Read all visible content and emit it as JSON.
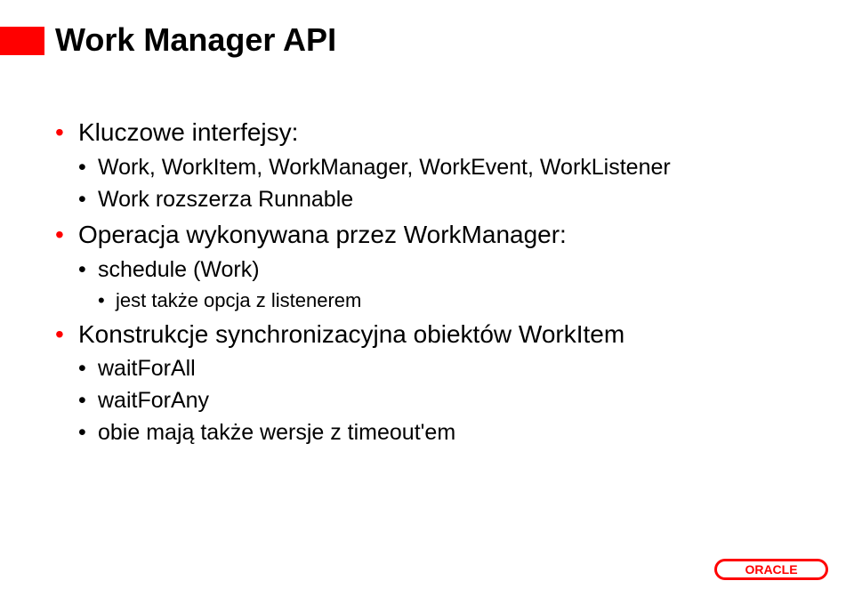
{
  "title": "Work Manager API",
  "bullets": [
    {
      "text": "Kluczowe interfejsy:",
      "children": [
        {
          "text": "Work, WorkItem, WorkManager, WorkEvent, WorkListener"
        },
        {
          "text": "Work rozszerza Runnable"
        }
      ]
    },
    {
      "text": "Operacja wykonywana przez WorkManager:",
      "children": [
        {
          "text": "schedule (Work)",
          "children": [
            {
              "text": "jest także opcja z listenerem"
            }
          ]
        }
      ]
    },
    {
      "text": "Konstrukcje synchronizacyjna obiektów WorkItem",
      "children": [
        {
          "text": "waitForAll"
        },
        {
          "text": "waitForAny"
        },
        {
          "text": "obie mają także wersje z timeout'em"
        }
      ]
    }
  ],
  "logo": "ORACLE"
}
